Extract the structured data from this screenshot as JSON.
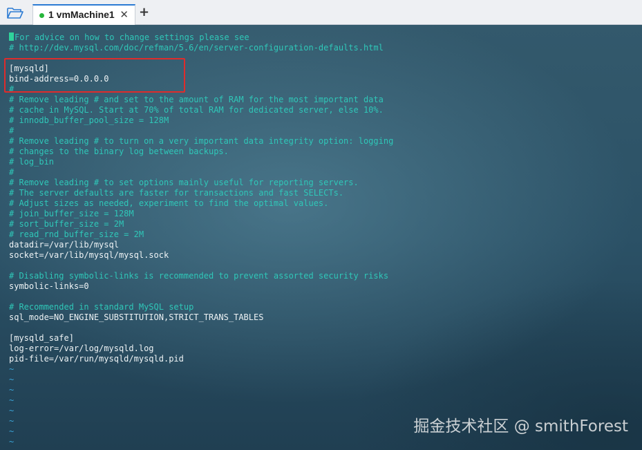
{
  "tab": {
    "title": "1 vmMachine1",
    "close": "✕"
  },
  "new_tab": "+",
  "editor": {
    "lines": [
      {
        "text": "For advice on how to change settings please see",
        "type": "comment"
      },
      {
        "text": "# http://dev.mysql.com/doc/refman/5.6/en/server-configuration-defaults.html",
        "type": "comment"
      },
      {
        "text": "",
        "type": "blank"
      },
      {
        "text": "[mysqld]",
        "type": "text"
      },
      {
        "text": "bind-address=0.0.0.0",
        "type": "text"
      },
      {
        "text": "#",
        "type": "comment"
      },
      {
        "text": "# Remove leading # and set to the amount of RAM for the most important data",
        "type": "comment"
      },
      {
        "text": "# cache in MySQL. Start at 70% of total RAM for dedicated server, else 10%.",
        "type": "comment"
      },
      {
        "text": "# innodb_buffer_pool_size = 128M",
        "type": "comment"
      },
      {
        "text": "#",
        "type": "comment"
      },
      {
        "text": "# Remove leading # to turn on a very important data integrity option: logging",
        "type": "comment"
      },
      {
        "text": "# changes to the binary log between backups.",
        "type": "comment"
      },
      {
        "text": "# log_bin",
        "type": "comment"
      },
      {
        "text": "#",
        "type": "comment"
      },
      {
        "text": "# Remove leading # to set options mainly useful for reporting servers.",
        "type": "comment"
      },
      {
        "text": "# The server defaults are faster for transactions and fast SELECTs.",
        "type": "comment"
      },
      {
        "text": "# Adjust sizes as needed, experiment to find the optimal values.",
        "type": "comment"
      },
      {
        "text": "# join_buffer_size = 128M",
        "type": "comment"
      },
      {
        "text": "# sort_buffer_size = 2M",
        "type": "comment"
      },
      {
        "text": "# read_rnd_buffer_size = 2M",
        "type": "comment"
      },
      {
        "text": "datadir=/var/lib/mysql",
        "type": "text"
      },
      {
        "text": "socket=/var/lib/mysql/mysql.sock",
        "type": "text"
      },
      {
        "text": "",
        "type": "blank"
      },
      {
        "text": "# Disabling symbolic-links is recommended to prevent assorted security risks",
        "type": "comment"
      },
      {
        "text": "symbolic-links=0",
        "type": "text"
      },
      {
        "text": "",
        "type": "blank"
      },
      {
        "text": "# Recommended in standard MySQL setup",
        "type": "comment"
      },
      {
        "text": "sql_mode=NO_ENGINE_SUBSTITUTION,STRICT_TRANS_TABLES",
        "type": "text"
      },
      {
        "text": "",
        "type": "blank"
      },
      {
        "text": "[mysqld_safe]",
        "type": "text"
      },
      {
        "text": "log-error=/var/log/mysqld.log",
        "type": "text"
      },
      {
        "text": "pid-file=/var/run/mysqld/mysqld.pid",
        "type": "text"
      },
      {
        "text": "~",
        "type": "tilde"
      },
      {
        "text": "~",
        "type": "tilde"
      },
      {
        "text": "~",
        "type": "tilde"
      },
      {
        "text": "~",
        "type": "tilde"
      },
      {
        "text": "~",
        "type": "tilde"
      },
      {
        "text": "~",
        "type": "tilde"
      },
      {
        "text": "~",
        "type": "tilde"
      },
      {
        "text": "~",
        "type": "tilde"
      }
    ]
  },
  "watermark": "掘金技术社区 @ smithForest",
  "colors": {
    "comment": "#2fc7b8",
    "text": "#eef3f5",
    "tilde": "#3aa5d8",
    "highlight_border": "#e02b2b",
    "tab_active_dot": "#27b63c"
  }
}
